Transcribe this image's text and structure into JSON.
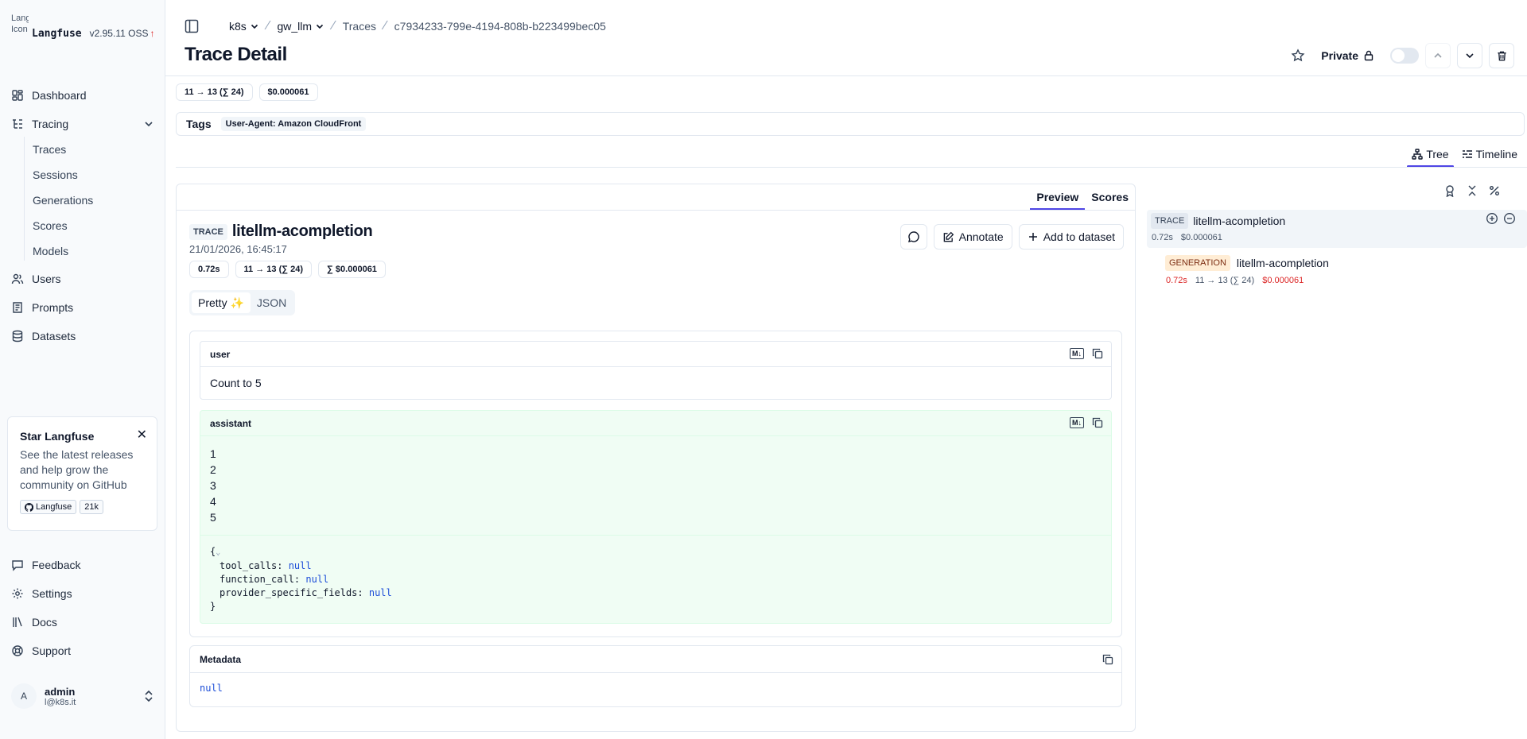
{
  "brand": {
    "logo_alt": "Langfuse Icon",
    "name": "Langfuse",
    "version": "v2.95.11 OSS",
    "update_arrow": "↑"
  },
  "sidebar": {
    "items": [
      {
        "label": "Dashboard",
        "icon": "dashboard-icon"
      },
      {
        "label": "Tracing",
        "icon": "tracing-icon"
      },
      {
        "label": "Users",
        "icon": "users-icon"
      },
      {
        "label": "Prompts",
        "icon": "prompts-icon"
      },
      {
        "label": "Datasets",
        "icon": "datasets-icon"
      }
    ],
    "tracing_sub": [
      "Traces",
      "Sessions",
      "Generations",
      "Scores",
      "Models"
    ],
    "bottom_items": [
      {
        "label": "Feedback",
        "icon": "feedback-icon"
      },
      {
        "label": "Settings",
        "icon": "settings-icon"
      },
      {
        "label": "Docs",
        "icon": "docs-icon"
      },
      {
        "label": "Support",
        "icon": "support-icon"
      }
    ],
    "promo": {
      "title": "Star Langfuse",
      "text": "See the latest releases and help grow the community on GitHub",
      "repo_label": "Langfuse",
      "stars": "21k"
    },
    "user": {
      "initial": "A",
      "name": "admin",
      "email": "l@k8s.it"
    }
  },
  "header": {
    "breadcrumb": {
      "org": "k8s",
      "project": "gw_llm",
      "section": "Traces",
      "trace_id": "c7934233-799e-4194-808b-b223499bec05"
    },
    "title": "Trace Detail",
    "private_label": "Private"
  },
  "usage_chips": {
    "tokens": "11 → 13 (∑ 24)",
    "cost": "$0.000061"
  },
  "tags": {
    "label": "Tags",
    "items": [
      "User-Agent: Amazon CloudFront"
    ]
  },
  "view_tabs": {
    "tree": "Tree",
    "timeline": "Timeline"
  },
  "preview": {
    "tabs": {
      "preview": "Preview",
      "scores": "Scores"
    },
    "kind": "TRACE",
    "name": "litellm-acompletion",
    "timestamp": "21/01/2026, 16:45:17",
    "chips": {
      "latency": "0.72s",
      "tokens": "11 → 13 (∑ 24)",
      "cost": "∑ $0.000061"
    },
    "actions": {
      "annotate": "Annotate",
      "add_dataset": "Add to dataset"
    },
    "format": {
      "pretty": "Pretty ✨",
      "json": "JSON"
    },
    "user_msg": {
      "role": "user",
      "content": "Count to 5"
    },
    "assistant_msg": {
      "role": "assistant",
      "lines": [
        "1",
        "2",
        "3",
        "4",
        "5"
      ],
      "json_open": "{",
      "collapse_glyph": "⌄",
      "json_fields": [
        {
          "key": "tool_calls",
          "value": "null"
        },
        {
          "key": "function_call",
          "value": "null"
        },
        {
          "key": "provider_specific_fields",
          "value": "null"
        }
      ],
      "json_close": "}"
    },
    "metadata": {
      "label": "Metadata",
      "value": "null"
    },
    "md_badge": "M↓"
  },
  "tree": {
    "root": {
      "kind": "TRACE",
      "name": "litellm-acompletion",
      "latency": "0.72s",
      "cost": "$0.000061"
    },
    "child": {
      "kind": "GENERATION",
      "name": "litellm-acompletion",
      "latency": "0.72s",
      "tokens": "11 → 13 (∑ 24)",
      "cost": "$0.000061"
    }
  }
}
